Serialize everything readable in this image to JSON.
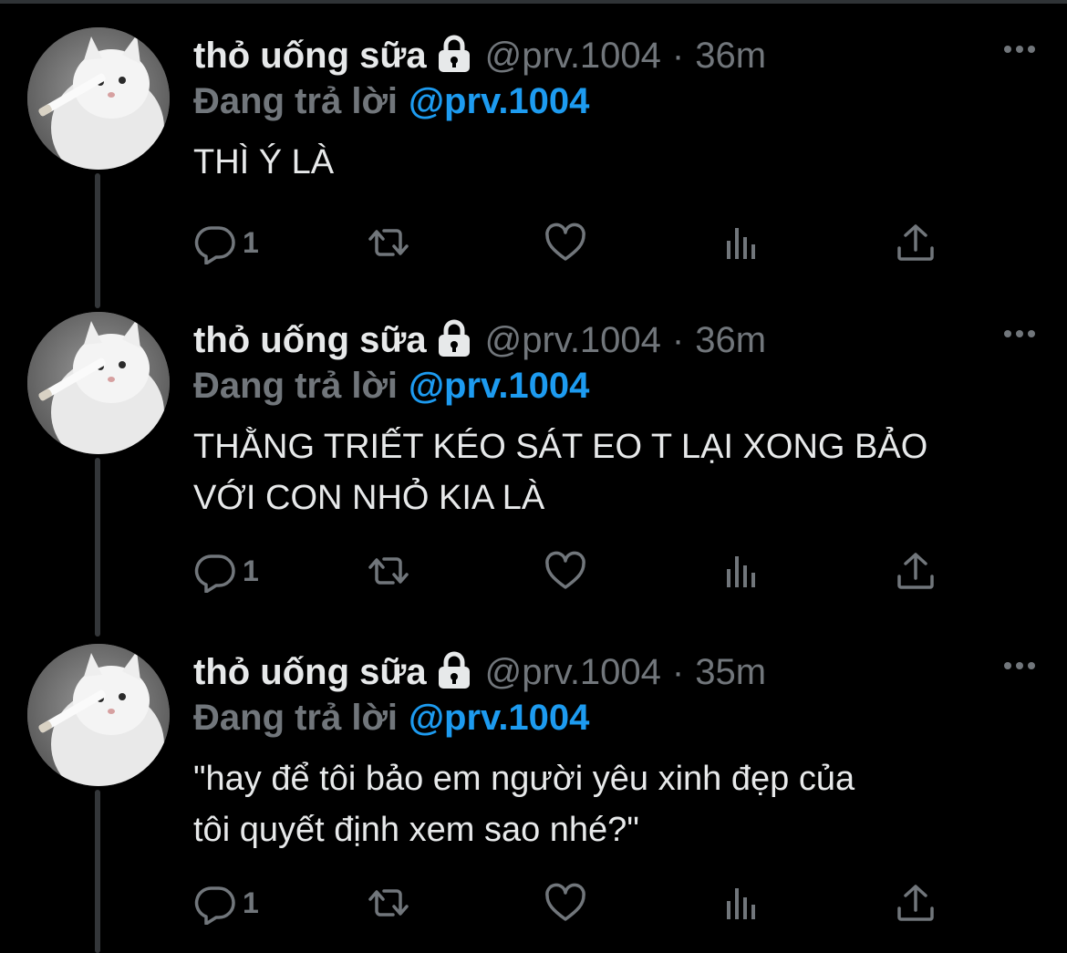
{
  "colors": {
    "background": "#000000",
    "text_primary": "#e7e9ea",
    "text_secondary": "#71767b",
    "link": "#1d9bf0",
    "thread_line": "#333639"
  },
  "tweets": [
    {
      "author_name": "thỏ uống sữa",
      "handle": "@prv.1004",
      "separator": "·",
      "time": "36m",
      "reply_label": "Đang trả lời",
      "reply_handle": "@prv.1004",
      "text": "THÌ Ý LÀ",
      "reply_count": "1",
      "icons": [
        "lock-icon",
        "more-icon",
        "reply-icon",
        "retweet-icon",
        "like-icon",
        "views-icon",
        "share-icon"
      ]
    },
    {
      "author_name": "thỏ uống sữa",
      "handle": "@prv.1004",
      "separator": "·",
      "time": "36m",
      "reply_label": "Đang trả lời",
      "reply_handle": "@prv.1004",
      "text": "THẰNG TRIẾT KÉO SÁT EO T LẠI XONG BẢO\nVỚI CON NHỎ KIA LÀ",
      "reply_count": "1",
      "icons": [
        "lock-icon",
        "more-icon",
        "reply-icon",
        "retweet-icon",
        "like-icon",
        "views-icon",
        "share-icon"
      ]
    },
    {
      "author_name": "thỏ uống sữa",
      "handle": "@prv.1004",
      "separator": "·",
      "time": "35m",
      "reply_label": "Đang trả lời",
      "reply_handle": "@prv.1004",
      "text": "\"hay để tôi bảo em người yêu xinh đẹp của\ntôi quyết định xem sao nhé?\"",
      "reply_count": "1",
      "icons": [
        "lock-icon",
        "more-icon",
        "reply-icon",
        "retweet-icon",
        "like-icon",
        "views-icon",
        "share-icon"
      ]
    }
  ]
}
